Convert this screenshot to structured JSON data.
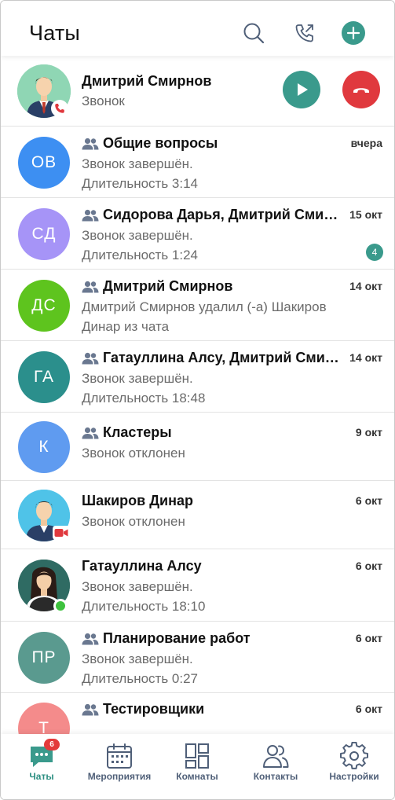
{
  "header": {
    "title": "Чаты",
    "actions": [
      "search-icon",
      "call-history-icon",
      "add-icon"
    ],
    "accent": "#3a9a8c"
  },
  "active_call": {
    "name": "Дмитрий Смирнов",
    "status": "Звонок",
    "accept_color": "#3a9a8c",
    "decline_color": "#e0393e"
  },
  "chats": [
    {
      "initials": "ОВ",
      "avatar_color": "#3d8ff2",
      "group": true,
      "title": "Общие вопросы",
      "line1": "Звонок завершён.",
      "line2": "Длительность 3:14",
      "date": "вчера",
      "unread": ""
    },
    {
      "initials": "СД",
      "avatar_color": "#a694f7",
      "group": true,
      "title": "Сидорова Дарья, Дмитрий Смирнов",
      "line1": "Звонок завершён.",
      "line2": "Длительность 1:24",
      "date": "15 окт",
      "unread": "4"
    },
    {
      "initials": "ДС",
      "avatar_color": "#5ec41e",
      "group": true,
      "title": "Дмитрий Смирнов",
      "line1": "Дмитрий Смирнов удалил (-а) Шакиров",
      "line2": "Динар из чата",
      "date": "14 окт",
      "unread": ""
    },
    {
      "initials": "ГА",
      "avatar_color": "#2b8f8c",
      "group": true,
      "title": "Гатауллина Алсу, Дмитрий Смирнов",
      "line1": "Звонок завершён.",
      "line2": "Длительность 18:48",
      "date": "14 окт",
      "unread": ""
    },
    {
      "initials": "К",
      "avatar_color": "#5f9bf0",
      "group": true,
      "title": "Кластеры",
      "line1": "Звонок отклонен",
      "line2": "",
      "date": "9 окт",
      "unread": ""
    },
    {
      "initials": "",
      "avatar_color": "#4fc3e8",
      "group": false,
      "title": "Шакиров Динар",
      "line1": "Звонок отклонен",
      "line2": "",
      "date": "6 окт",
      "unread": ""
    },
    {
      "initials": "",
      "avatar_color": "#2f6b63",
      "group": false,
      "title": "Гатауллина Алсу",
      "line1": "Звонок завершён.",
      "line2": "Длительность 18:10",
      "date": "6 окт",
      "unread": ""
    },
    {
      "initials": "ПР",
      "avatar_color": "#5a9a8f",
      "group": true,
      "title": "Планирование работ",
      "line1": "Звонок завершён.",
      "line2": "Длительность 0:27",
      "date": "6 окт",
      "unread": ""
    },
    {
      "initials": "Т",
      "avatar_color": "#f48b8b",
      "group": true,
      "title": "Тестировщики",
      "line1": "",
      "line2": "",
      "date": "6 окт",
      "unread": ""
    }
  ],
  "nav": {
    "chats": {
      "label": "Чаты",
      "badge": "6"
    },
    "events": {
      "label": "Мероприятия"
    },
    "rooms": {
      "label": "Комнаты"
    },
    "contacts": {
      "label": "Контакты"
    },
    "settings": {
      "label": "Настройки"
    }
  }
}
